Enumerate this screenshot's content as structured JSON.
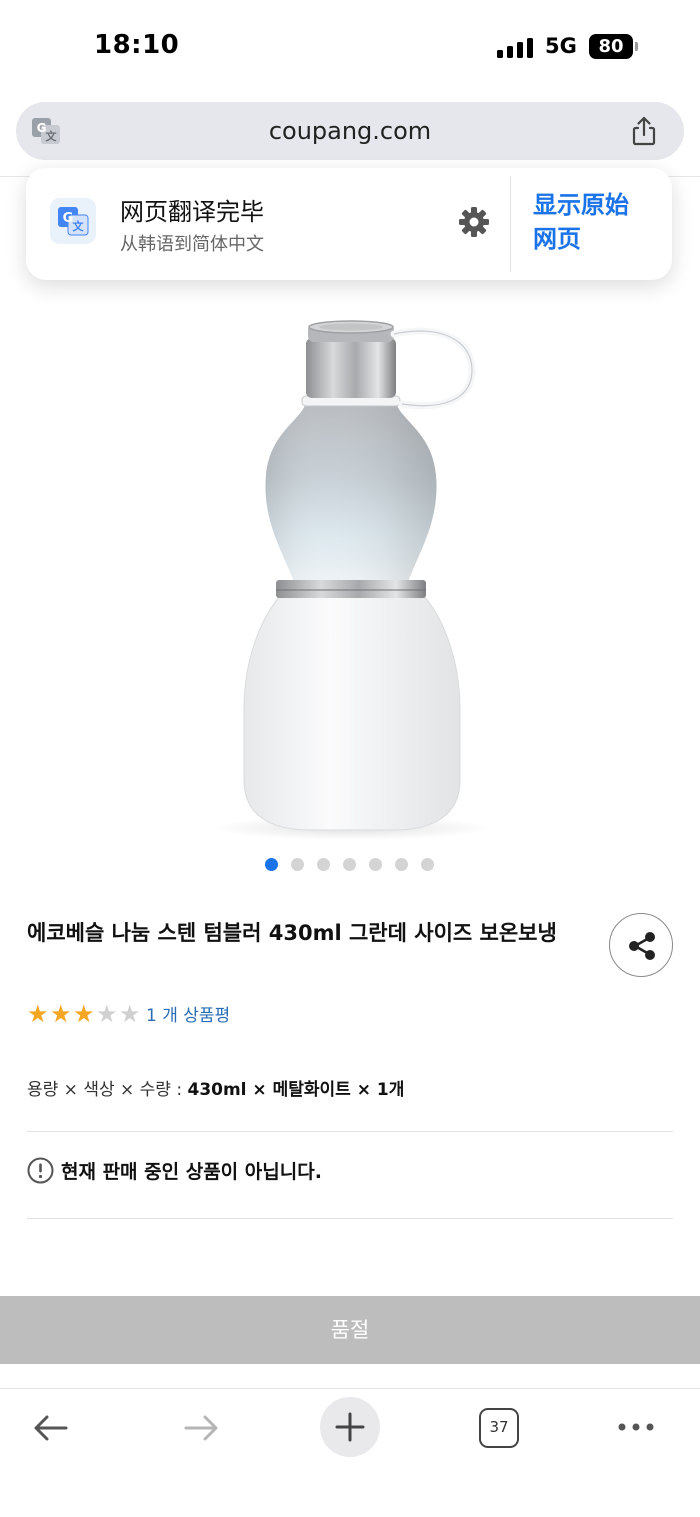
{
  "status_bar": {
    "time": "18:10",
    "network": "5G",
    "battery": "80"
  },
  "url_bar": {
    "url": "coupang.com"
  },
  "translate_popup": {
    "title": "网页翻译完毕",
    "subtitle": "从韩语到简体中文",
    "show_original_line1": "显示原始",
    "show_original_line2": "网页"
  },
  "product": {
    "title": "에코베슬 나눔 스텐 텀블러 430ml 그란데 사이즈 보온보냉",
    "rating": 3,
    "rating_max": 5,
    "review_count": "1 개 상품평",
    "image_count": 7,
    "active_image": 1,
    "option_label": "용량 × 색상 × 수량 : ",
    "option_value": "430ml × 메탈화이트 × 1개",
    "notice": "현재 판매 중인 상품이 아닙니다.",
    "soldout_label": "품절"
  },
  "toolbar": {
    "tab_count": "37"
  },
  "colors": {
    "accent": "#1a73e8",
    "star": "#f5a623",
    "star_empty": "#d0d0d0",
    "soldout_bg": "#bdbdbd",
    "review_link": "#2a6db5"
  }
}
